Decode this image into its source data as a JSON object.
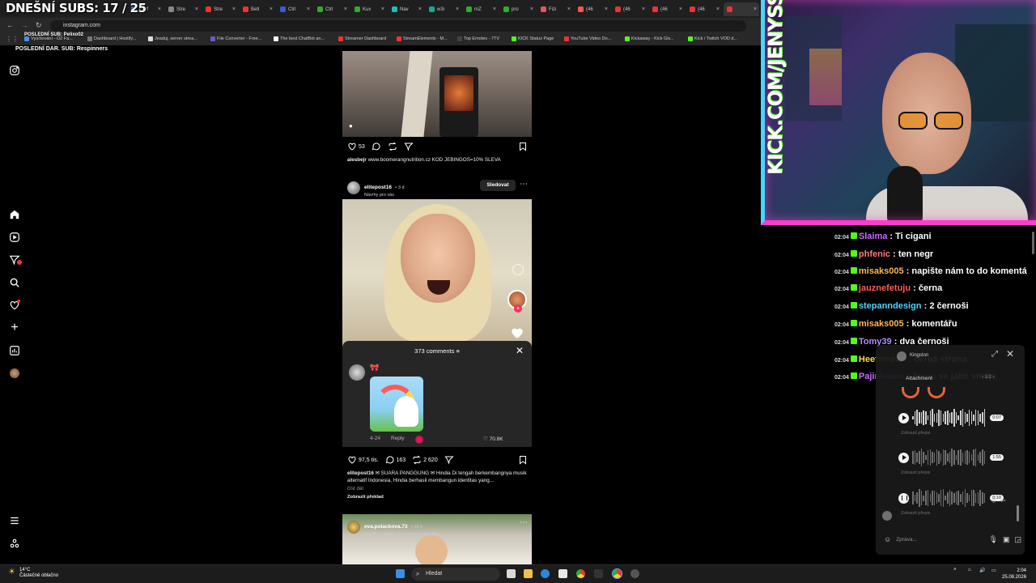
{
  "overlay": {
    "subs_today": "DNEŠNÍ SUBS: 17 / 25",
    "last_sub": "POSLEDNÍ SUB: Pelixo02",
    "last_donation": "POSLEDNÍ DAR. SUB: Respinners"
  },
  "browser": {
    "tabs": [
      "Prof",
      "Stre",
      "Stre",
      "Beti",
      "Ctrl",
      "Ctrl",
      "Kuv",
      "Nav",
      "w3i",
      "mZ",
      "pro",
      "Fizi",
      "(46",
      "(46",
      "(46",
      "(46",
      ""
    ],
    "url": "instagram.com",
    "bookmarks": [
      "Vyúčtování - O2 Fa...",
      "Dashboard | Hostify...",
      "Jeaduj, server strea...",
      "File Converter - Free...",
      "The best ChatBot an...",
      "Streamer Dashboard",
      "StreamElements - M...",
      "Top Emotes - 7TV",
      "KICK Status Page",
      "YouTube Video Do...",
      "Kickaway - Kick Giv...",
      "Kick / Twitch VOD d..."
    ]
  },
  "feed": {
    "post1": {
      "likes": "53",
      "caption_user": "alesbejr",
      "caption_text": "www.boomerangnutrition.cz KOD JEBINGOS=10% SLEVA"
    },
    "post2": {
      "user": "elitepost16",
      "time": "• 3 d",
      "subtitle": "Návrhy pro vás",
      "follow_label": "Sledovat",
      "comments_title": "373 comments",
      "comment_emoji": "🎀",
      "comment_date": "4-24",
      "reply_label": "Reply",
      "comment_likes": "70.8K",
      "likes": "97,5 tis.",
      "comments": "163",
      "reposts": "2 620",
      "caption_user": "elitepost16",
      "caption_text": "✉ SUARA PANGGUNG ✉ Hindia Di tengah berkembangnya musik alternatif Indonesia, Hindia berhasil membangun identitas yang...",
      "more_label": "číst dál",
      "translate_label": "Zobrazit překlad"
    },
    "post3": {
      "user": "eva.polackova.73",
      "time": "• 16 h",
      "subtitle": "SONNY JINAK • Ať je dobsu život líbí"
    }
  },
  "stream": {
    "channel_banner": "KICK.COM/JENYSS",
    "chat": [
      {
        "time": "02:04",
        "user": "Slaima",
        "color": "#c86bff",
        "msg": "Ti cigani"
      },
      {
        "time": "02:04",
        "user": "phfenic",
        "color": "#ff7a7a",
        "msg": "ten negr"
      },
      {
        "time": "02:04",
        "user": "misaks005",
        "color": "#ffb84d",
        "msg": "napište nám to do komentá"
      },
      {
        "time": "02:04",
        "user": "jauznefetuju",
        "color": "#ff5a5a",
        "msg": "černa"
      },
      {
        "time": "02:04",
        "user": "stepanndesign",
        "color": "#4fd3ff",
        "msg": "2 černoši"
      },
      {
        "time": "02:04",
        "user": "misaks005",
        "color": "#ffb84d",
        "msg": "komentářu"
      },
      {
        "time": "02:04",
        "user": "Tomy39",
        "color": "#b48cff",
        "msg": "dva černoši"
      },
      {
        "time": "02:04",
        "user": "Heetsmean",
        "color": "#ffd84a",
        "msg": "černá strana"
      },
      {
        "time": "02:04",
        "user": "Pajinkaaax",
        "color": "#c86bff",
        "msg": "čemu se jako směje"
      }
    ]
  },
  "messenger": {
    "contact": "Kingston",
    "attachment_label": "Attachment",
    "pager": "1/2",
    "voice_messages": [
      {
        "duration": "0:07",
        "transcript": "Zobrazit přepis"
      },
      {
        "duration": "1:55",
        "transcript": "Zobrazit přepis"
      },
      {
        "duration": "0:10",
        "transcript": "Zobrazit přepis"
      }
    ],
    "input_placeholder": "Zpráva..."
  },
  "taskbar": {
    "temperature": "14°C",
    "weather": "Částečně oblačno",
    "search": "Hledat",
    "time": "2:04",
    "date": "25.08.2026"
  }
}
